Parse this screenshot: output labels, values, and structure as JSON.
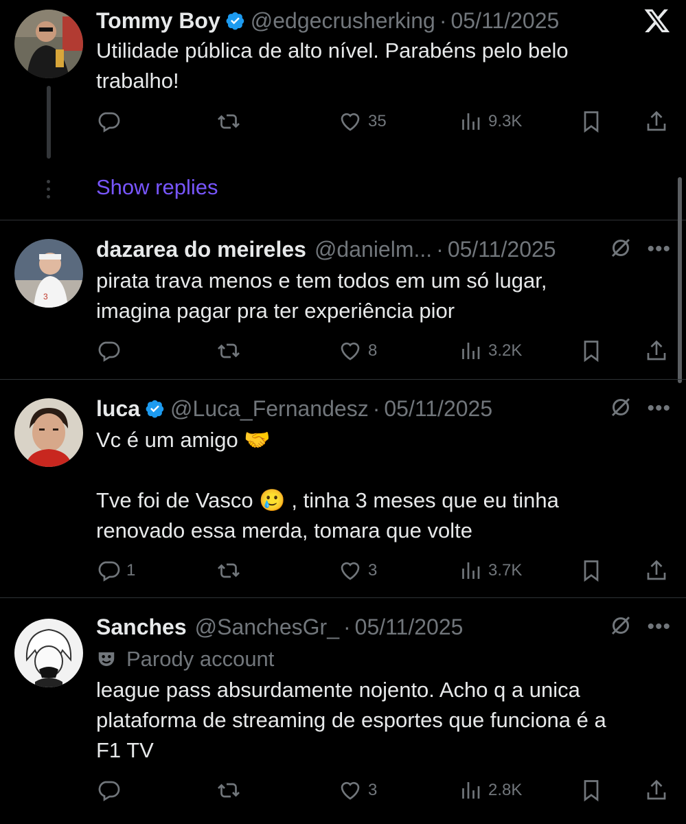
{
  "tweets": [
    {
      "name": "Tommy Boy",
      "verified": true,
      "handle": "@edgecrusherking",
      "date": "05/11/2025",
      "text": "Utilidade pública de alto nível. Parabéns pelo belo\ntrabalho!",
      "replies": "",
      "likes": "35",
      "views": "9.3K",
      "show_replies": "Show replies"
    },
    {
      "name": "dazarea do meireles",
      "verified": false,
      "handle": "@danielm...",
      "date": "05/11/2025",
      "text": "pirata trava menos e tem todos em um só lugar,\nimagina pagar pra ter experiência pior",
      "replies": "",
      "likes": "8",
      "views": "3.2K"
    },
    {
      "name": "luca",
      "verified": true,
      "handle": "@Luca_Fernandesz",
      "date": "05/11/2025",
      "text": "Vc é um amigo 🤝\n\nTve foi de Vasco 🥲 , tinha 3 meses que eu tinha\nrenovado essa merda, tomara que volte",
      "replies": "1",
      "likes": "3",
      "views": "3.7K"
    },
    {
      "name": "Sanches",
      "verified": false,
      "handle": "@SanchesGr_",
      "date": "05/11/2025",
      "parody_label": "Parody account",
      "text": "league pass absurdamente nojento. Acho q a unica\nplataforma de streaming de esportes que funciona é a\nF1 TV",
      "replies": "",
      "likes": "3",
      "views": "2.8K"
    }
  ],
  "icons": {
    "app_logo": "x-logo-icon",
    "reply": "reply-icon",
    "retweet": "retweet-icon",
    "like": "heart-icon",
    "views": "views-chart-icon",
    "bookmark": "bookmark-icon",
    "share": "share-icon",
    "muted": "grok-slash-icon",
    "more": "more-dots-icon",
    "verified": "verified-badge-icon",
    "parody": "theater-mask-icon"
  },
  "colors": {
    "background": "#000000",
    "text": "#e7e9ea",
    "secondary": "#71767b",
    "verified": "#1d9bf0",
    "link": "#7856ff",
    "divider": "#2f3336"
  }
}
